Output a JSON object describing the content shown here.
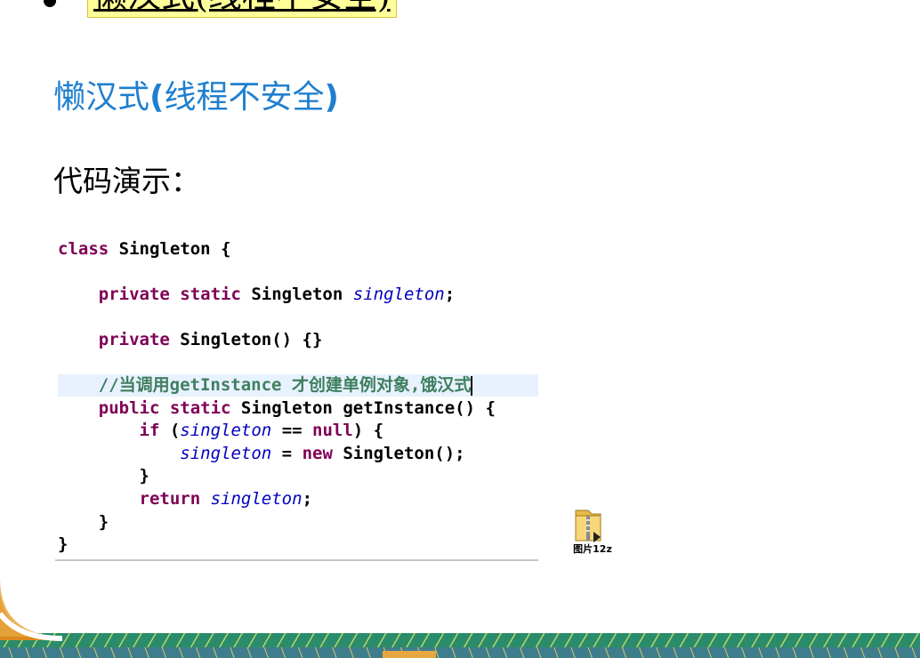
{
  "header": {
    "prev_title": "懒汉式(线程不安全)"
  },
  "section": {
    "title_text": "懒汉式",
    "title_paren_open": "(",
    "title_sub": "线程不安全",
    "title_paren_close": ")",
    "code_label": "代码演示："
  },
  "code": {
    "l1_kw": "class",
    "l1_rest": " Singleton {",
    "l2_kw": "private static",
    "l2_type": " Singleton ",
    "l2_field": "singleton",
    "l2_end": ";",
    "l3_kw": "private",
    "l3_rest": " Singleton() {}",
    "l4_comment": "//当调用getInstance 才创建单例对象,饿汉式",
    "l5_kw": "public static",
    "l5_rest": " Singleton getInstance() {",
    "l6_kw": "if",
    "l6_open": " (",
    "l6_field": "singleton",
    "l6_mid": " == ",
    "l6_null": "null",
    "l6_end": ") {",
    "l7_field": "singleton",
    "l7_mid": " = ",
    "l7_new": "new",
    "l7_end": " Singleton();",
    "l8_brace": "}",
    "l9_kw": "return",
    "l9_sp": " ",
    "l9_field": "singleton",
    "l9_end": ";",
    "l10_brace": "}",
    "l11_brace": "}"
  },
  "attachment": {
    "label": "图片12z",
    "icon": "zip-folder-icon"
  },
  "colors": {
    "title_blue": "#1f7fcf",
    "keyword": "#7f0055",
    "field": "#0000c0",
    "comment": "#3f7f5f",
    "highlight": "#ffff99"
  }
}
